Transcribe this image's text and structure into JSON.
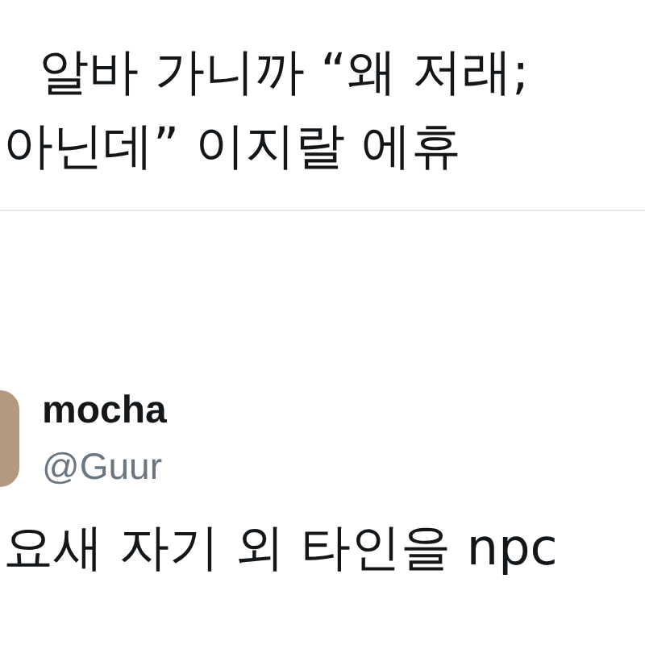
{
  "quoted_tweet": {
    "lines": [
      "알바 가니까 “왜 저래;",
      "아닌데” 이지랄 에휴"
    ]
  },
  "tweet": {
    "display_name": "mocha",
    "handle": "@Guur",
    "lines": [
      "요새 자기 외 타인을 npc"
    ]
  }
}
